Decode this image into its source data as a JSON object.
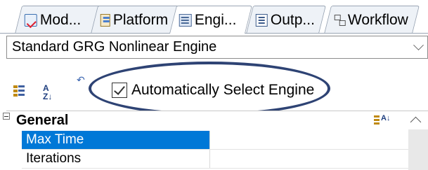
{
  "tabs": [
    {
      "label": "Mod...",
      "icon": "model-icon",
      "active": false
    },
    {
      "label": "Platform",
      "icon": "platform-icon",
      "active": false
    },
    {
      "label": "Engi...",
      "icon": "engine-icon",
      "active": true
    },
    {
      "label": "Outp...",
      "icon": "output-icon",
      "active": false
    },
    {
      "label": "Workflow",
      "icon": "workflow-icon",
      "active": false
    }
  ],
  "engine_select": {
    "value": "Standard GRG Nonlinear Engine"
  },
  "toolbar": {
    "auto_select": {
      "label": "Automatically Select Engine",
      "checked": true
    }
  },
  "property_grid": {
    "category": "General",
    "rows": [
      {
        "name": "Max Time",
        "value": "",
        "selected": true
      },
      {
        "name": "Iterations",
        "value": "",
        "selected": false
      }
    ]
  },
  "colors": {
    "selection": "#0078d7",
    "annotation_ellipse": "#2e4374"
  }
}
